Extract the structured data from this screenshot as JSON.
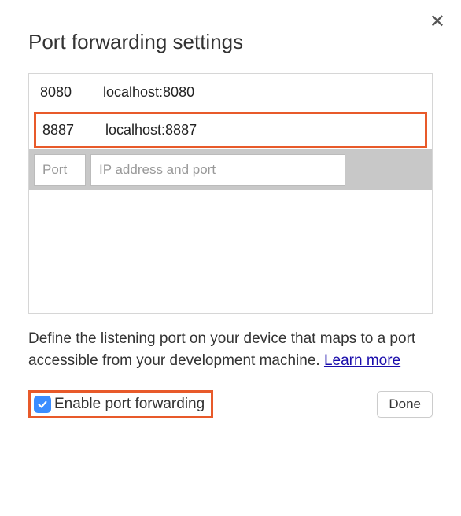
{
  "title": "Port forwarding settings",
  "rows": [
    {
      "port": "8080",
      "address": "localhost:8080",
      "highlighted": false
    },
    {
      "port": "8887",
      "address": "localhost:8887",
      "highlighted": true
    }
  ],
  "inputs": {
    "port_placeholder": "Port",
    "address_placeholder": "IP address and port"
  },
  "description": {
    "text": "Define the listening port on your device that maps to a port accessible from your development machine. ",
    "link_text": "Learn more"
  },
  "footer": {
    "checkbox_label": "Enable port forwarding",
    "checkbox_checked": true,
    "done_label": "Done"
  }
}
